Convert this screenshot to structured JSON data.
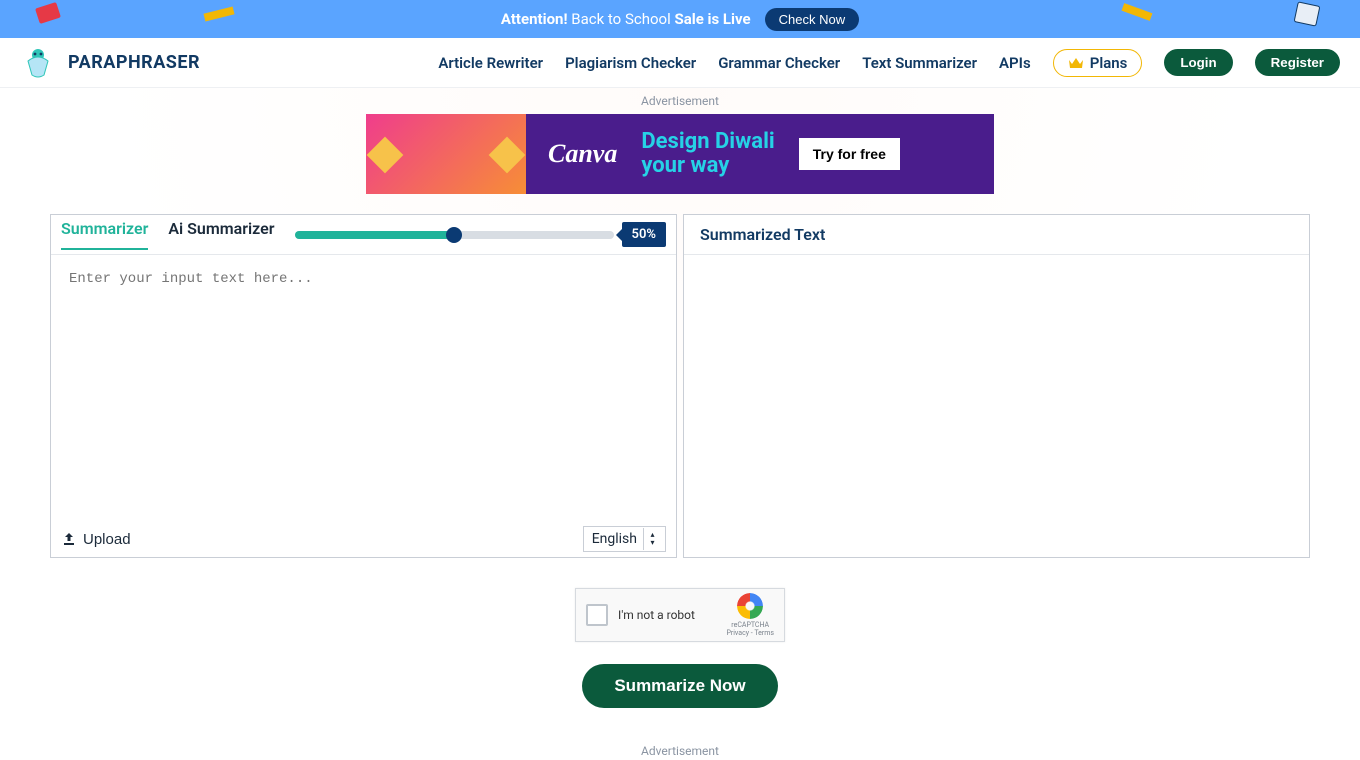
{
  "banner": {
    "attention": "Attention!",
    "message": "Back to School",
    "sale": "Sale is Live",
    "cta": "Check Now"
  },
  "brand": {
    "name": "PARAPHRASER"
  },
  "nav": {
    "links": [
      "Article Rewriter",
      "Plagiarism Checker",
      "Grammar Checker",
      "Text Summarizer",
      "APIs"
    ],
    "plans": "Plans",
    "login": "Login",
    "register": "Register"
  },
  "ads": {
    "label": "Advertisement"
  },
  "ad_block": {
    "brand": "Canva",
    "headline_line1": "Design Diwali",
    "headline_line2": "your way",
    "cta": "Try for free"
  },
  "left_panel": {
    "tabs": {
      "summarizer": "Summarizer",
      "ai_summarizer": "Ai Summarizer"
    },
    "slider_percent": 50,
    "slider_label": "50%",
    "placeholder": "Enter your input text here...",
    "upload": "Upload",
    "language_selected": "English"
  },
  "right_panel": {
    "title": "Summarized Text"
  },
  "recaptcha": {
    "label": "I'm not a robot",
    "brand": "reCAPTCHA",
    "legal": "Privacy - Terms"
  },
  "actions": {
    "summarize": "Summarize Now"
  }
}
